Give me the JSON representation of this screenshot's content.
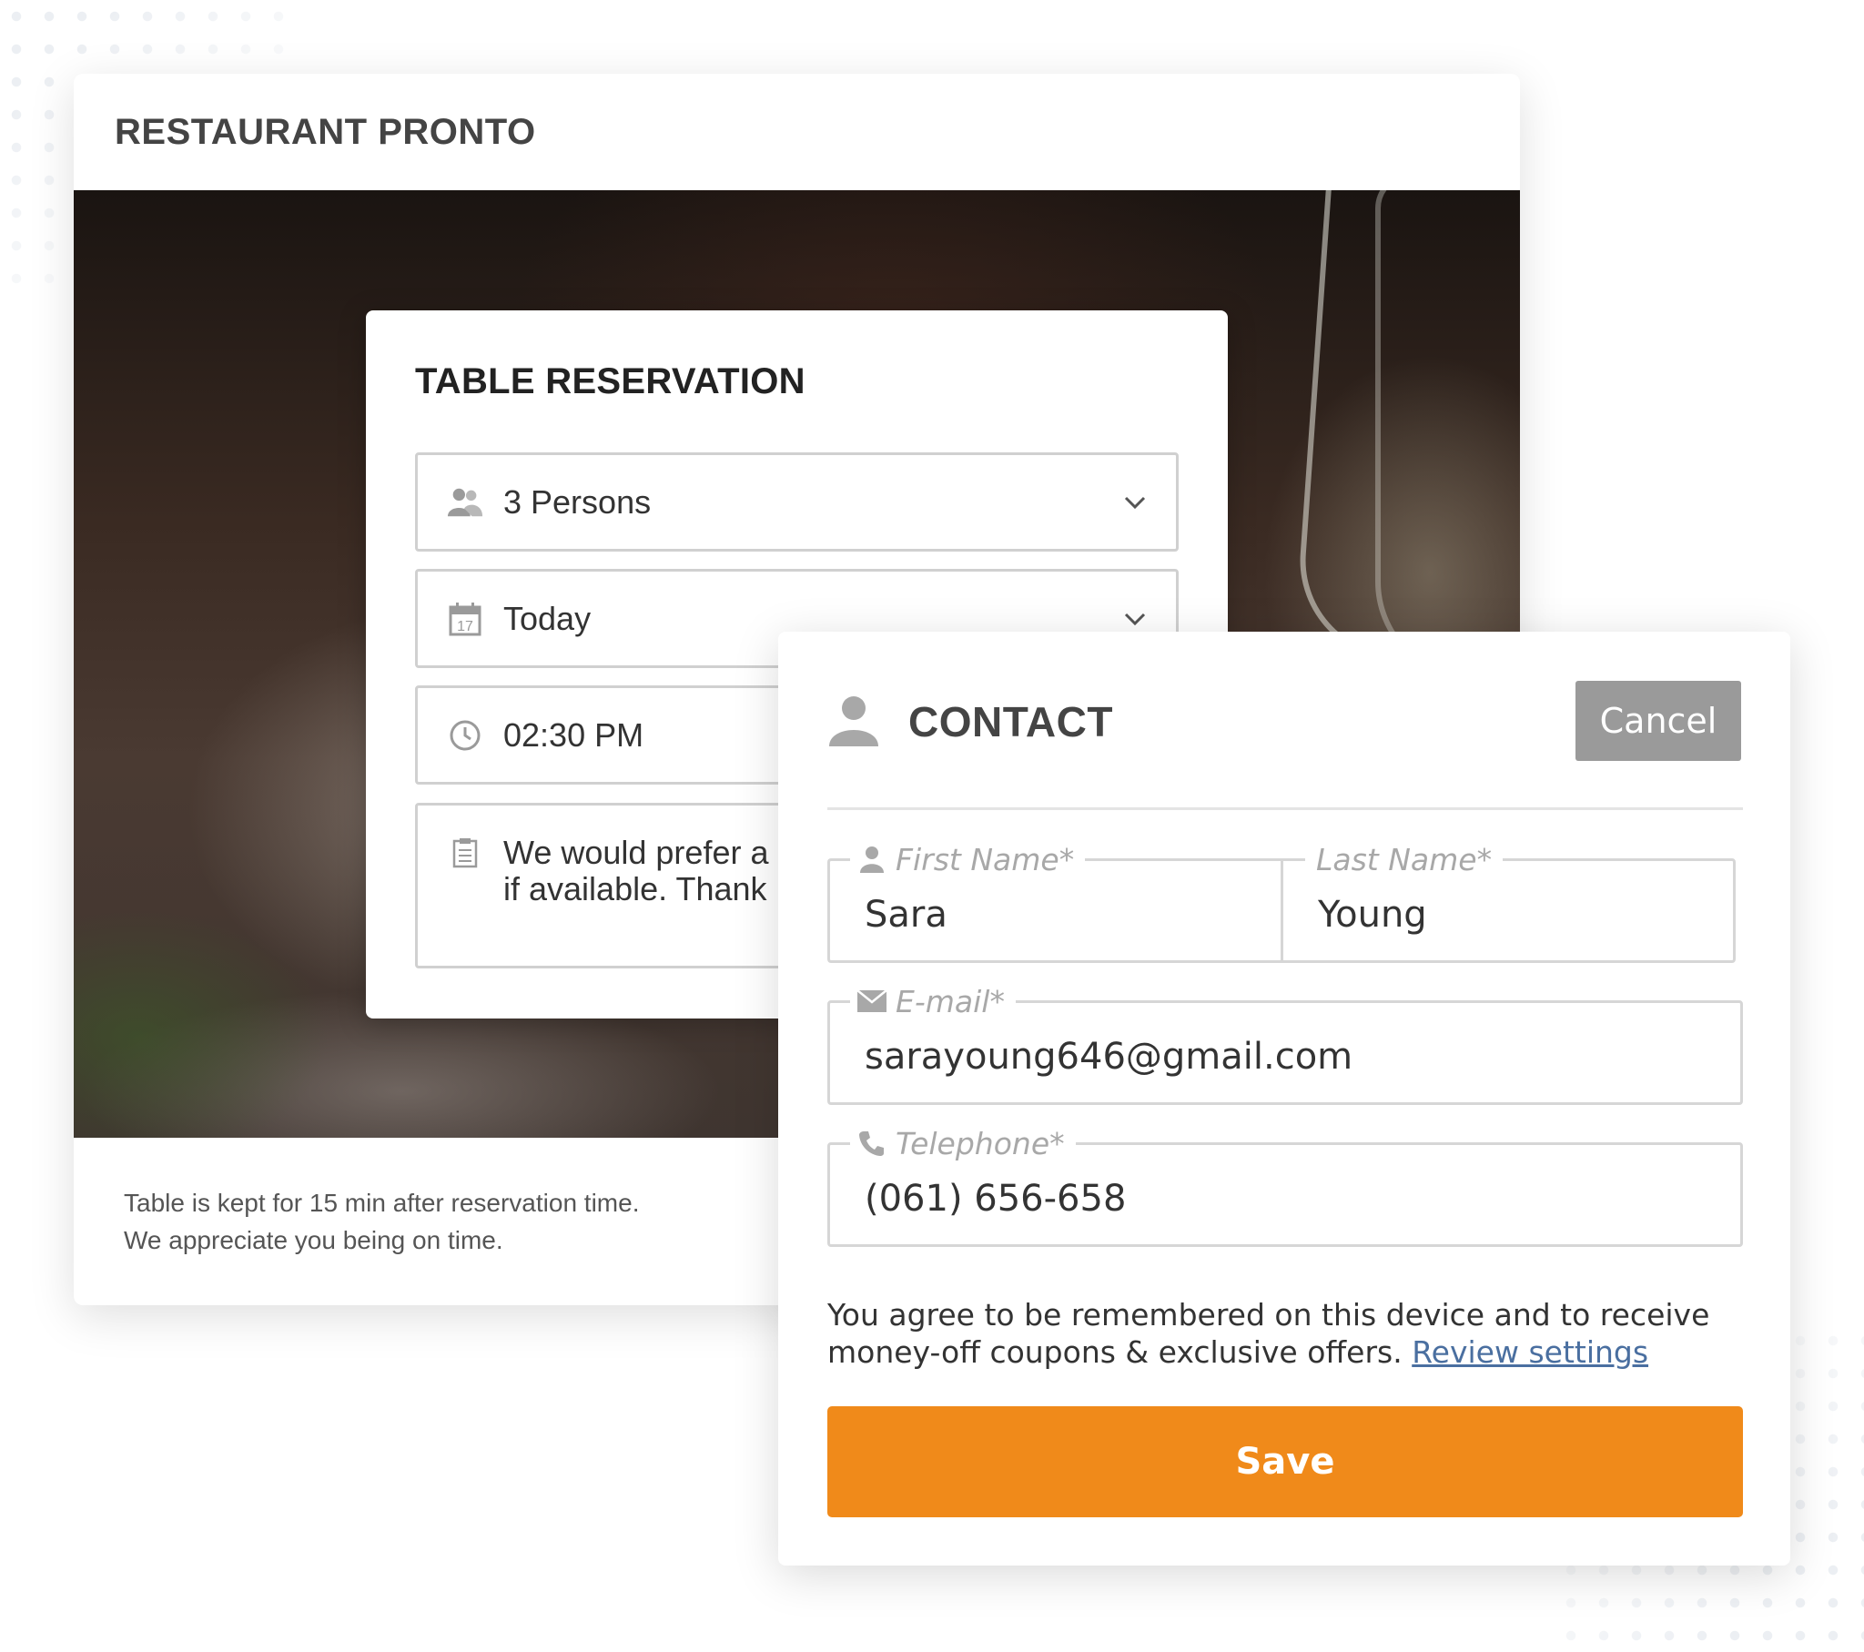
{
  "restaurant": {
    "title": "RESTAURANT PRONTO",
    "footer_line1": "Table is kept for 15 min after reservation time.",
    "footer_line2": "We appreciate you being on time."
  },
  "reservation": {
    "title": "TABLE RESERVATION",
    "persons": {
      "value": "3 Persons",
      "icon": "people-icon"
    },
    "date": {
      "value": "Today",
      "icon": "calendar-icon",
      "icon_text": "17"
    },
    "time": {
      "value": "02:30 PM",
      "icon": "clock-icon"
    },
    "note": {
      "line1": "We would prefer a",
      "line2": "if available. Thank",
      "icon": "note-icon"
    }
  },
  "contact": {
    "title": "CONTACT",
    "cancel_label": "Cancel",
    "first_name": {
      "label": "First Name*",
      "value": "Sara"
    },
    "last_name": {
      "label": "Last Name*",
      "value": "Young"
    },
    "email": {
      "label": "E-mail*",
      "value": "sarayoung646@gmail.com"
    },
    "telephone": {
      "label": "Telephone*",
      "value": "(061) 656-658"
    },
    "consent_text": "You agree to be remembered on this device and to receive money-off coupons & exclusive offers.",
    "review_link": "Review settings",
    "save_label": "Save"
  },
  "colors": {
    "accent": "#f08a1a",
    "cancel_bg": "#9a9a9a",
    "link": "#4a6fa0"
  }
}
